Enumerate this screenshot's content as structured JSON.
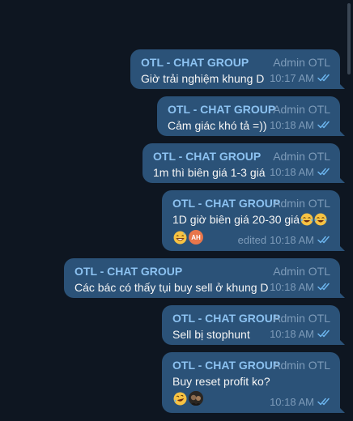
{
  "colors": {
    "background": "#0e1621",
    "bubble": "#2b5278",
    "sender": "#8cc2f1",
    "meta": "#7d9bb9",
    "text": "#f5f5f5"
  },
  "messages": [
    {
      "sender": "OTL - CHAT GROUP",
      "role": "Admin OTL",
      "text": "Giờ trải nghiệm khung D",
      "time": "10:17 AM",
      "status_icon": "double-check-icon"
    },
    {
      "sender": "OTL - CHAT GROUP",
      "role": "Admin OTL",
      "text": "Cảm giác khó tả =))",
      "time": "10:18 AM",
      "status_icon": "double-check-icon"
    },
    {
      "sender": "OTL - CHAT GROUP",
      "role": "Admin OTL",
      "text": "1m thì biên giá 1-3 giá",
      "time": "10:18 AM",
      "status_icon": "double-check-icon"
    },
    {
      "sender": "OTL - CHAT GROUP",
      "role": "Admin OTL",
      "text": "1D giờ biên giá 20-30 giá",
      "text_emojis": [
        "laughing-tears-emoji",
        "laughing-tears-emoji"
      ],
      "edited_label": "edited",
      "time": "10:18 AM",
      "status_icon": "double-check-icon",
      "reactions": [
        "grinning-sweat-emoji",
        "avatar-ah"
      ],
      "reaction_avatar_initials": "AH"
    },
    {
      "sender": "OTL - CHAT GROUP",
      "role": "Admin OTL",
      "text": "Các bác có thấy tụi buy sell ở khung D",
      "time": "10:18 AM",
      "status_icon": "double-check-icon"
    },
    {
      "sender": "OTL - CHAT GROUP",
      "role": "Admin OTL",
      "text": "Sell bị stophunt",
      "time": "10:18 AM",
      "status_icon": "double-check-icon"
    },
    {
      "sender": "OTL - CHAT GROUP",
      "role": "Admin OTL",
      "text": "Buy reset profit ko?",
      "time": "10:18 AM",
      "status_icon": "double-check-icon",
      "reactions": [
        "rofl-emoji",
        "avatar-photo"
      ]
    }
  ]
}
